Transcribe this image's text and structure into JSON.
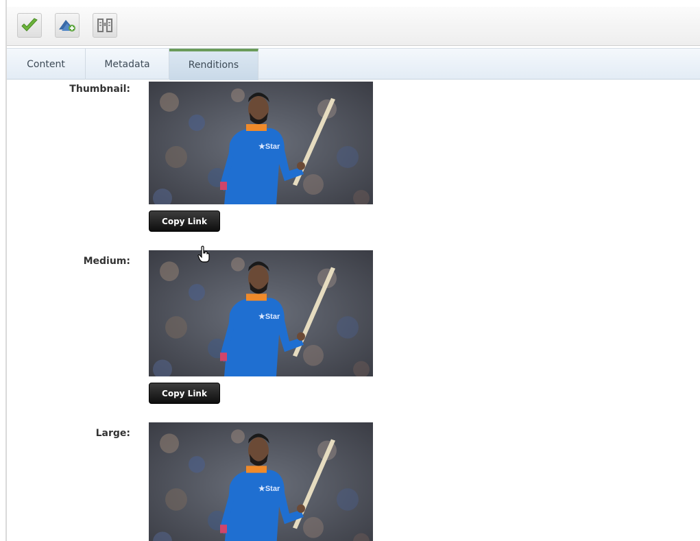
{
  "toolbar": {
    "buttons": [
      {
        "icon": "checkmark-icon",
        "color": "#6bb33a"
      },
      {
        "icon": "tree-add-icon",
        "color": "#3a6aa8"
      },
      {
        "icon": "binoculars-icon",
        "color": "#8a8a8a"
      }
    ]
  },
  "tabs": [
    {
      "label": "Content",
      "active": false
    },
    {
      "label": "Metadata",
      "active": false
    },
    {
      "label": "Renditions",
      "active": true
    }
  ],
  "renditions": [
    {
      "label": "Thumbnail:",
      "button": "Copy Link"
    },
    {
      "label": "Medium:",
      "button": "Copy Link"
    },
    {
      "label": "Large:"
    }
  ],
  "colors": {
    "active_tab_accent": "#6a9b5a",
    "jersey": "#1f6fd1",
    "copy_button": "#111111"
  }
}
